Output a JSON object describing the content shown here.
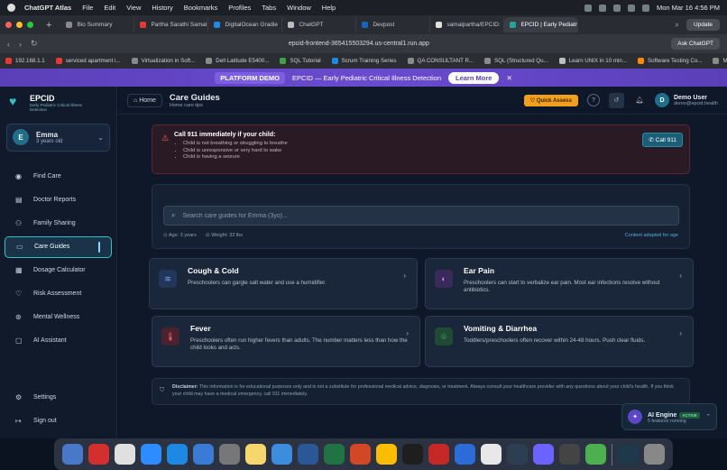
{
  "menubar": {
    "app": "ChatGPT Atlas",
    "items": [
      "File",
      "Edit",
      "View",
      "History",
      "Bookmarks",
      "Profiles",
      "Tabs",
      "Window",
      "Help"
    ],
    "datetime": "Mon Mar 16  4:56 PM"
  },
  "tabs": [
    {
      "label": "Bio Summary",
      "color": "#8a8a8a"
    },
    {
      "label": "Partha Sarathi Samal",
      "color": "#e53935"
    },
    {
      "label": "DigitalOcean Gradie",
      "color": "#1e88e5"
    },
    {
      "label": "ChatGPT",
      "color": "#bdbdbd"
    },
    {
      "label": "Devpost",
      "color": "#1565c0"
    },
    {
      "label": "samalpartha/EPCID:",
      "color": "#e0e0e0"
    },
    {
      "label": "EPCID | Early Pediatr",
      "color": "#26a69a"
    }
  ],
  "browser": {
    "update_label": "Update",
    "url": "epcid-frontend-365415503294.us-central1.run.app",
    "ask_label": "Ask ChatGPT"
  },
  "bookmarks": [
    {
      "label": "192.168.1.1",
      "color": "#e53935"
    },
    {
      "label": "serviced apartment i...",
      "color": "#e53935"
    },
    {
      "label": "Virtualization in Soft...",
      "color": "#8a8a8a"
    },
    {
      "label": "Dell Latitude E5400...",
      "color": "#8a8a8a"
    },
    {
      "label": "SQL Tutorial",
      "color": "#43a047"
    },
    {
      "label": "Scrum Training Series",
      "color": "#1e88e5"
    },
    {
      "label": "QA CONSULTANT R...",
      "color": "#8a8a8a"
    },
    {
      "label": "SQL (Structured Qu...",
      "color": "#8a8a8a"
    },
    {
      "label": "Learn UNIX in 10 min...",
      "color": "#bdbdbd"
    },
    {
      "label": "Software Testing Co...",
      "color": "#fb8c00"
    },
    {
      "label": "Mobile Python",
      "color": "#8a8a8a"
    }
  ],
  "banner": {
    "pill": "PLATFORM DEMO",
    "text": "EPCID — Early Pediatric Critical Illness Detection",
    "learn": "Learn More",
    "close": "✕"
  },
  "sidebar": {
    "brand": "EPCID",
    "brand_sub": "Early Pediatric Critical Illness Detection",
    "profile": {
      "initial": "E",
      "name": "Emma",
      "age": "3 years old"
    },
    "items": [
      {
        "label": "Find Care",
        "icon": "◉"
      },
      {
        "label": "Doctor Reports",
        "icon": "▤"
      },
      {
        "label": "Family Sharing",
        "icon": "⚇"
      },
      {
        "label": "Care Guides",
        "icon": "▭"
      },
      {
        "label": "Dosage Calculator",
        "icon": "▦"
      },
      {
        "label": "Risk Assessment",
        "icon": "♡"
      },
      {
        "label": "Mental Wellness",
        "icon": "⊛"
      },
      {
        "label": "AI Assistant",
        "icon": "▢"
      }
    ],
    "settings": "Settings",
    "signout": "Sign out"
  },
  "header": {
    "home": "Home",
    "title": "Care Guides",
    "subtitle": "Home care tips",
    "quick": "Quick Assess",
    "user_initial": "D",
    "user_name": "Demo User",
    "user_email": "demo@epcid.health"
  },
  "alert": {
    "heading": "Call 911 immediately if your child:",
    "items": [
      "Child is not breathing or struggling to breathe",
      "Child is unresponsive or very hard to wake",
      "Child is having a seizure"
    ],
    "call_label": "Call 911"
  },
  "search": {
    "placeholder": "Search care guides for Emma (3yo)...",
    "age": "Age: 3 years",
    "weight": "Weight: 32 lbs",
    "adapted": "Content adapted for age"
  },
  "guides": [
    {
      "title": "Cough & Cold",
      "desc": "Preschoolers can gargle salt water and use a humidifier.",
      "icon": "≋",
      "icon_color": "#6fa8ff",
      "icon_bg": "#22365a"
    },
    {
      "title": "Ear Pain",
      "desc": "Preschoolers can start to verbalize ear pain. Most ear infections resolve without antibiotics.",
      "icon": "◐",
      "icon_color": "#c07cff",
      "icon_bg": "#3a2a5a"
    },
    {
      "title": "Fever",
      "desc": "Preschoolers often run higher fevers than adults. The number matters less than how the child looks and acts.",
      "icon": "🌡",
      "icon_color": "#ff6b6b",
      "icon_bg": "#4a2230"
    },
    {
      "title": "Vomiting & Diarrhea",
      "desc": "Toddlers/preschoolers often recover within 24-48 hours. Push clear fluids.",
      "icon": "♧",
      "icon_color": "#5fe08a",
      "icon_bg": "#1f4a34"
    }
  ],
  "disclaimer": {
    "label": "Disclaimer:",
    "text": "This information is for educational purposes only and is not a substitute for professional medical advice, diagnosis, or treatment. Always consult your healthcare provider with any questions about your child's health. If you think your child may have a medical emergency, call 911 immediately."
  },
  "ai_widget": {
    "title": "AI Engine",
    "status": "ACTIVE",
    "sub": "5 features running"
  },
  "dock": [
    "#4a78c8",
    "#d32f2f",
    "#e0e0e0",
    "#2d8cff",
    "#1e88e5",
    "#3a7bd5",
    "#777",
    "#f5d76e",
    "#3c8dde",
    "#2b5797",
    "#217346",
    "#d24726",
    "#fbbc05",
    "#1e1e1e",
    "#c62828",
    "#2b6cd8",
    "#e8e8e8",
    "#2c3e50",
    "#6c63ff",
    "#444",
    "#4caf50",
    "#1e3a4a",
    "#888"
  ]
}
